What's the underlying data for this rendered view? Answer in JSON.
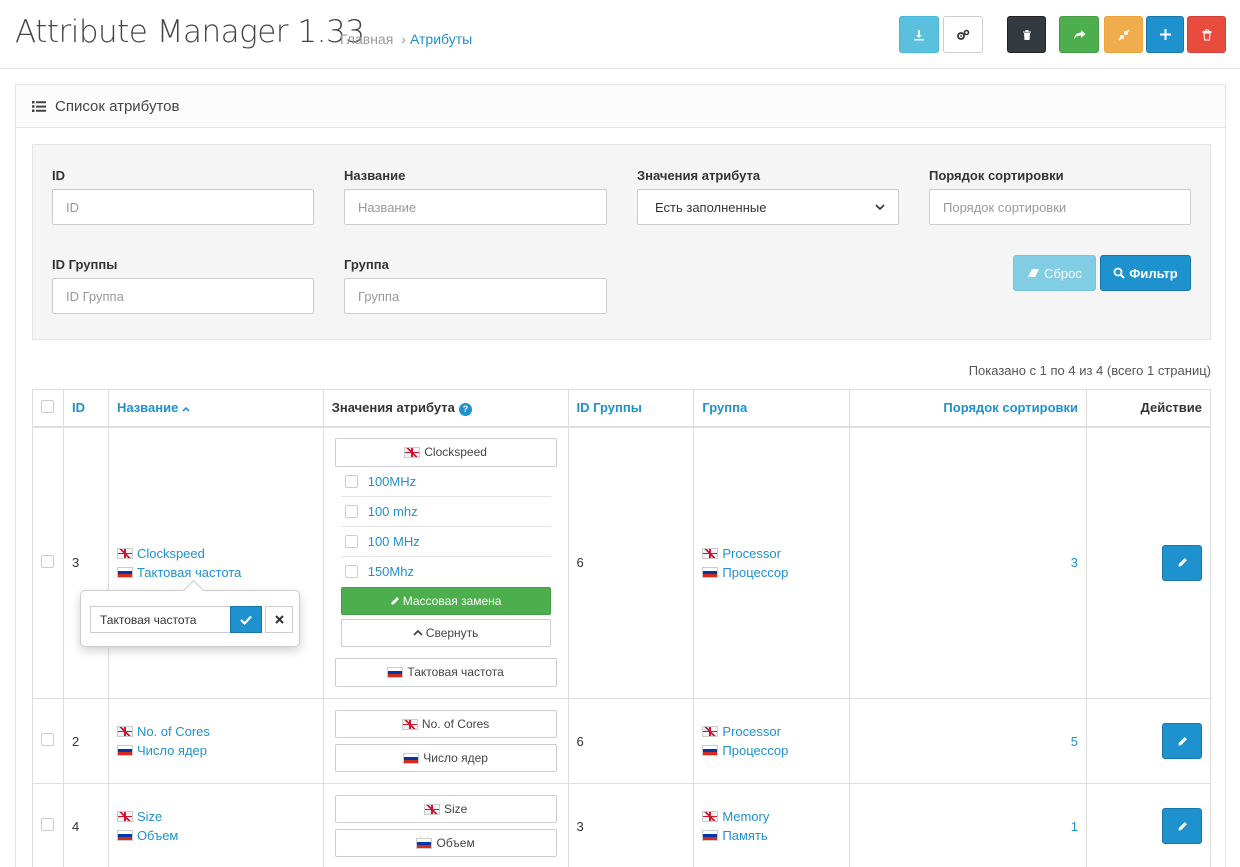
{
  "header": {
    "title": "Attribute Manager 1.33",
    "breadcrumb": [
      "Главная",
      "Атрибуты"
    ],
    "breadcrumb_sep": "›"
  },
  "panel": {
    "title": "Список атрибутов"
  },
  "filter": {
    "id_label": "ID",
    "id_placeholder": "ID",
    "name_label": "Название",
    "name_placeholder": "Название",
    "values_label": "Значения атрибута",
    "values_selected": "Есть заполненные",
    "sort_label": "Порядок сортировки",
    "sort_placeholder": "Порядок сортировки",
    "group_id_label": "ID Группы",
    "group_id_placeholder": "ID Группа",
    "group_label": "Группа",
    "group_placeholder": "Группа",
    "reset_label": "Сброс",
    "filter_label": "Фильтр"
  },
  "pagination": {
    "info": "Показано с 1 по 4 из 4 (всего 1 страниц)"
  },
  "table": {
    "headers": {
      "id": "ID",
      "name": "Название",
      "values": "Значения атрибута",
      "group_id": "ID Группы",
      "group": "Группа",
      "sort": "Порядок сортировки",
      "action": "Действие"
    },
    "rows": [
      {
        "id": "3",
        "name_en": "Clockspeed",
        "name_ru": "Тактовая частота",
        "values_en": "Clockspeed",
        "values_ru": "Тактовая частота",
        "value_items": [
          "100MHz",
          "100 mhz",
          "100 MHz",
          "150Mhz"
        ],
        "mass_replace": "Массовая замена",
        "collapse": "Свернуть",
        "group_id": "6",
        "group_en": "Processor",
        "group_ru": "Процессор",
        "sort": "3"
      },
      {
        "id": "2",
        "name_en": "No. of Cores",
        "name_ru": "Число ядер",
        "values_en": "No. of Cores",
        "values_ru": "Число ядер",
        "group_id": "6",
        "group_en": "Processor",
        "group_ru": "Процессор",
        "sort": "5"
      },
      {
        "id": "4",
        "name_en": "Size",
        "name_ru": "Объем",
        "values_en": "Size",
        "values_ru": "Объем",
        "group_id": "3",
        "group_en": "Memory",
        "group_ru": "Память",
        "sort": "1"
      }
    ]
  },
  "popover": {
    "value": "Тактовая частота"
  },
  "colors": {
    "primary": "#1e91cf",
    "info": "#5bc0de",
    "success": "#4cae4c",
    "warning": "#f0ad4e",
    "danger": "#e74c3c",
    "dark": "#333b41"
  },
  "icons": [
    "download-icon",
    "cogs-icon",
    "trash-icon",
    "share-icon",
    "compress-icon",
    "plus-icon",
    "delete-icon",
    "list-icon",
    "eraser-icon",
    "search-icon",
    "pencil-icon",
    "check-icon",
    "close-icon",
    "chevron-up-icon",
    "chevron-down-icon",
    "sort-asc-icon",
    "help-icon",
    "flag-en-icon",
    "flag-ru-icon"
  ]
}
